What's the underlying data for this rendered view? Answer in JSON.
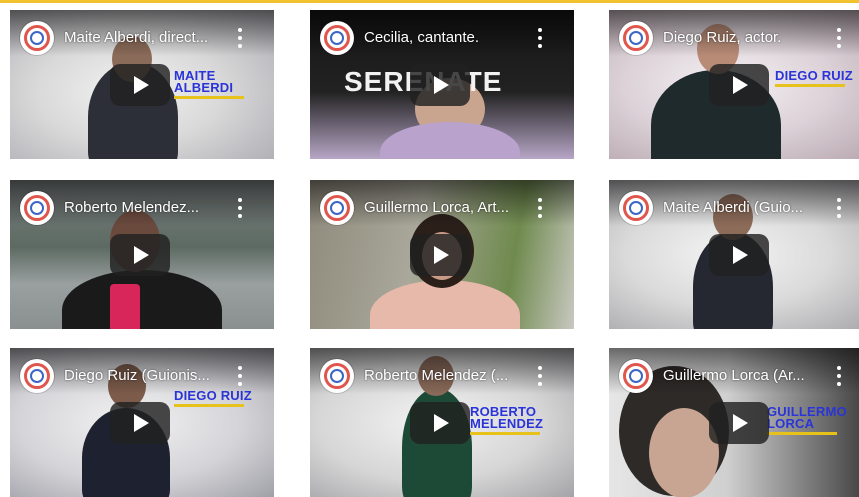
{
  "colors": {
    "accent_top_line": "#f2c230",
    "name_tag_blue": "#2a34d8",
    "name_tag_yellow": "#e8c21c",
    "play_button": "#212121"
  },
  "videos": [
    {
      "title": "Maite Alberdi, direct...",
      "overlay_name": "MAITE ALBERDI",
      "overlay_word": "",
      "play_icon": "play-icon",
      "logo_icon": "channel-logo-icon",
      "menu_icon": "more-vert-icon"
    },
    {
      "title": "Cecilia, cantante.",
      "overlay_name": "",
      "overlay_word": "SERENATE",
      "play_icon": "play-icon",
      "logo_icon": "channel-logo-icon",
      "menu_icon": "more-vert-icon"
    },
    {
      "title": "Diego Ruiz, actor.",
      "overlay_name": "DIEGO RUIZ",
      "overlay_word": "",
      "play_icon": "play-icon",
      "logo_icon": "channel-logo-icon",
      "menu_icon": "more-vert-icon"
    },
    {
      "title": "Roberto Melendez...",
      "overlay_name": "",
      "overlay_word": "",
      "play_icon": "play-icon",
      "logo_icon": "channel-logo-icon",
      "menu_icon": "more-vert-icon"
    },
    {
      "title": "Guillermo Lorca, Art...",
      "overlay_name": "",
      "overlay_word": "",
      "play_icon": "play-icon",
      "logo_icon": "channel-logo-icon",
      "menu_icon": "more-vert-icon"
    },
    {
      "title": "Maite Alberdi (Guio...",
      "overlay_name": "",
      "overlay_word": "",
      "play_icon": "play-icon",
      "logo_icon": "channel-logo-icon",
      "menu_icon": "more-vert-icon"
    },
    {
      "title": "Diego Ruiz (Guionis...",
      "overlay_name": "DIEGO RUIZ",
      "overlay_word": "",
      "play_icon": "play-icon",
      "logo_icon": "channel-logo-icon",
      "menu_icon": "more-vert-icon"
    },
    {
      "title": "Roberto Melendez (...",
      "overlay_name": "ROBERTO MELENDEZ",
      "overlay_word": "",
      "play_icon": "play-icon",
      "logo_icon": "channel-logo-icon",
      "menu_icon": "more-vert-icon"
    },
    {
      "title": "Guillermo Lorca (Ar...",
      "overlay_name": "GUILLERMO LORCA",
      "overlay_word": "",
      "play_icon": "play-icon",
      "logo_icon": "channel-logo-icon",
      "menu_icon": "more-vert-icon"
    }
  ]
}
